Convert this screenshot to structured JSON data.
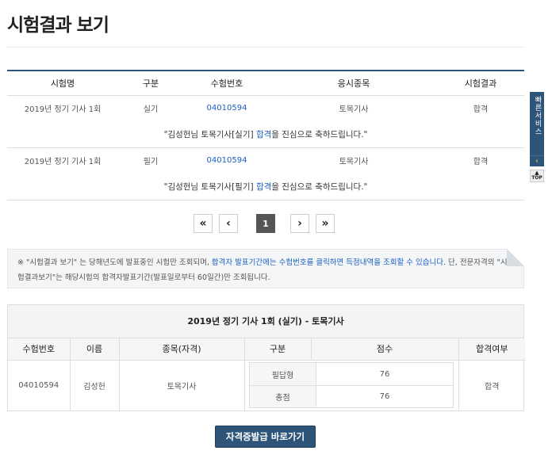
{
  "page": {
    "title": "시험결과 보기"
  },
  "results": {
    "headers": [
      "시험명",
      "구분",
      "수험번호",
      "응시종목",
      "시험결과"
    ],
    "rows": [
      {
        "exam": "2019년 정기 기사 1회",
        "type": "실기",
        "number": "04010594",
        "field": "토목기사",
        "result": "합격",
        "message_pre": "\"김성헌님 토목기사[실기] ",
        "message_hl": "합격",
        "message_post": "을 진심으로 축하드립니다.\""
      },
      {
        "exam": "2019년 정기 기사 1회",
        "type": "필기",
        "number": "04010594",
        "field": "토목기사",
        "result": "합격",
        "message_pre": "\"김성헌님 토목기사[필기] ",
        "message_hl": "합격",
        "message_post": "을 진심으로 축하드립니다.\""
      }
    ]
  },
  "pager": {
    "first": "«",
    "prev": "‹",
    "current": "1",
    "next": "›",
    "last": "»"
  },
  "notice": {
    "part1": "※ \"시험결과 보기\" 는 당해년도에 발표중인 시험만 조회되며, ",
    "part2": "합격자 발표기간에는 수험번호를 클릭하면 득점내역을 조회할 수 있습니다.",
    "part3": " 단, 전문자격의 \"시험결과보기\"는 해당시험의 합격자발표기간(발표일로부터 60일간)만 조회됩니다."
  },
  "detail": {
    "title": "2019년 정기 기사 1회 (실기) - 토목기사",
    "headers": [
      "수험번호",
      "이름",
      "종목(자격)",
      "구분",
      "점수",
      "합격여부"
    ],
    "number": "04010594",
    "name": "김성헌",
    "field": "토목기사",
    "scores": [
      {
        "label": "필답형",
        "value": "76"
      },
      {
        "label": "총점",
        "value": "76"
      }
    ],
    "result": "합격"
  },
  "cert_button": "자격증발급 바로가기",
  "side": {
    "tab_label": "빠른서비스",
    "arrow": "‹",
    "top_label": "TOP"
  },
  "colors": {
    "accent": "#2d5479",
    "link": "#1a5fc2"
  }
}
